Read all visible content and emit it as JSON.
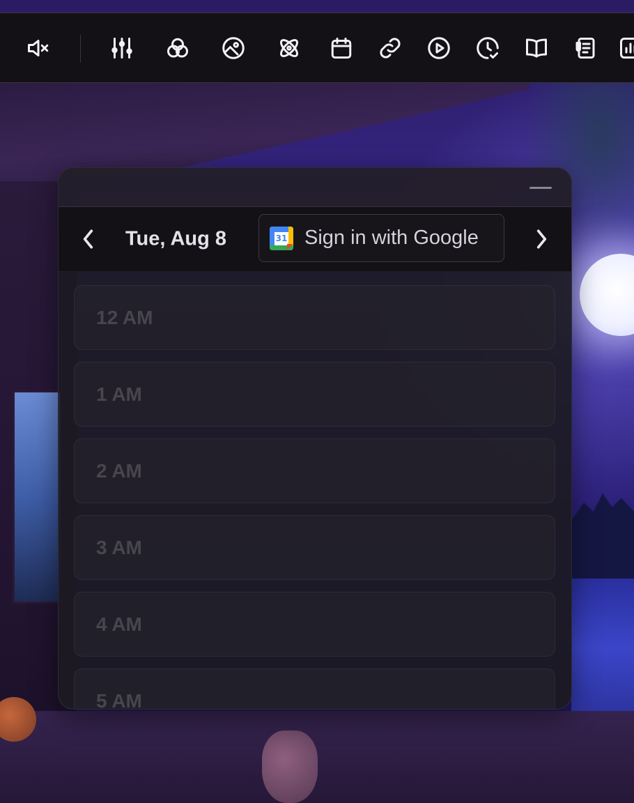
{
  "toolbar": {
    "icons": [
      "mute-icon",
      "equalizer-icon",
      "color-filter-icon",
      "image-icon",
      "atom-icon",
      "calendar-icon",
      "link-icon",
      "play-icon",
      "clock-check-icon",
      "book-icon",
      "notes-icon",
      "chart-icon"
    ]
  },
  "calendar": {
    "date": "Tue, Aug 8",
    "google_button": {
      "label": "Sign in with Google",
      "icon": "google-calendar-icon",
      "icon_number": "31"
    },
    "prev_icon": "chevron-left-icon",
    "next_icon": "chevron-right-icon",
    "time_slots": [
      "12 AM",
      "1 AM",
      "2 AM",
      "3 AM",
      "4 AM",
      "5 AM"
    ]
  },
  "colors": {
    "toolbar_bg": "#131016",
    "panel_bg": "#1c1a22",
    "slot_text": "#47454d",
    "google_blue": "#4285f4",
    "google_green": "#34a853",
    "google_yellow": "#fbbc04",
    "google_red": "#ea4335"
  }
}
